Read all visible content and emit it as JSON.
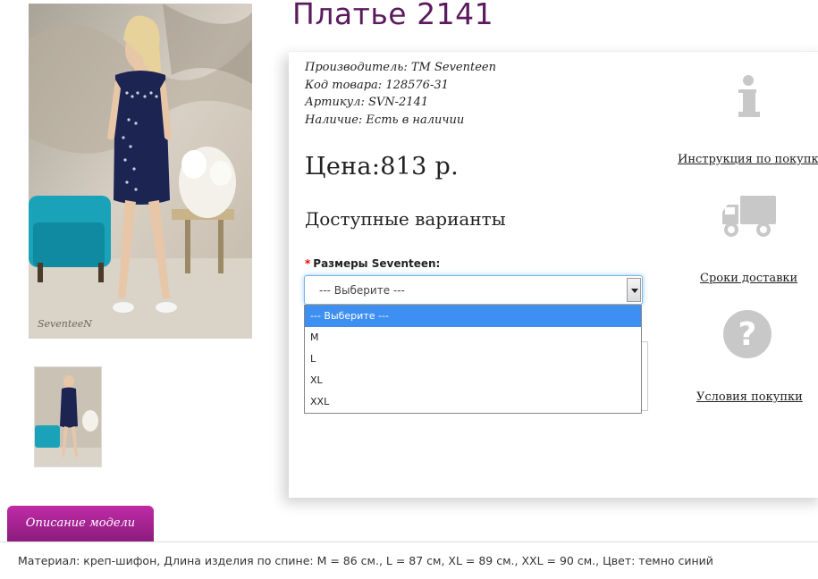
{
  "product": {
    "title": "Платье 2141",
    "meta": [
      {
        "label": "Производитель:",
        "value": "TM Seventeen"
      },
      {
        "label": "Код товара:",
        "value": "128576-31"
      },
      {
        "label": "Артикул:",
        "value": "SVN-2141"
      },
      {
        "label": "Наличие:",
        "value": "Есть в наличии"
      }
    ],
    "price": "Цена:813 р.",
    "variants_title": "Доступные варианты",
    "photo_watermark": "SeventeeN"
  },
  "size_select": {
    "required_mark": "*",
    "label": "Размеры Seventeen:",
    "value": "--- Выберите ---",
    "options": [
      "--- Выберите ---",
      "M",
      "L",
      "XL",
      "XXL"
    ],
    "selected_index": 0
  },
  "side_links": {
    "instruction": "Инструкция по покупке",
    "delivery": "Сроки доставки",
    "terms": "Условия покупки"
  },
  "tabs": {
    "description_tab": "Описание модели"
  },
  "description": "Материал: креп-шифон, Длина изделия по спине: M = 86 см., L = 87 см, XL = 89 см., XXL = 90 см., Цвет: темно синий"
}
